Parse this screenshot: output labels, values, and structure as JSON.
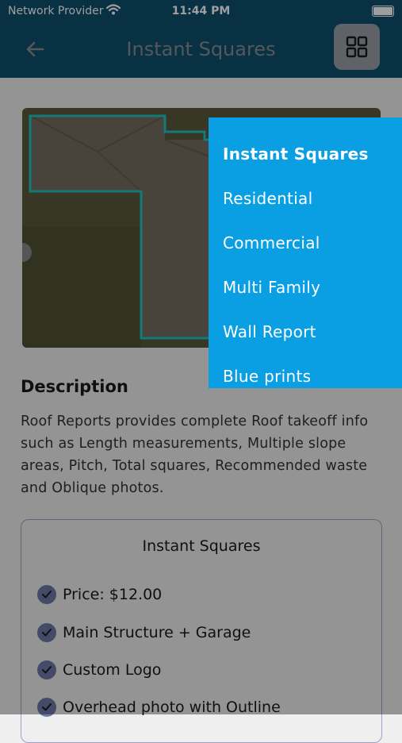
{
  "status_bar": {
    "carrier": "Network Provider",
    "time": "11:44 PM"
  },
  "app_bar": {
    "title": "Instant Squares"
  },
  "description": {
    "title": "Description",
    "text": "Roof Reports provides complete Roof takeoff info such as Length measurements, Multiple slope areas, Pitch, Total squares, Recommended waste and Oblique photos."
  },
  "card": {
    "title": "Instant Squares",
    "features": [
      "Price: $12.00",
      "Main Structure + Garage",
      "Custom Logo",
      "Overhead photo with Outline"
    ]
  },
  "menu": {
    "items": [
      "Instant Squares",
      "Residential",
      "Commercial",
      "Multi Family",
      "Wall Report",
      "Blue prints"
    ]
  },
  "colors": {
    "header": "#0d4f6f",
    "menu": "#0a9ee3",
    "check": "#6e7aa8",
    "outline": "#20c3c3"
  }
}
